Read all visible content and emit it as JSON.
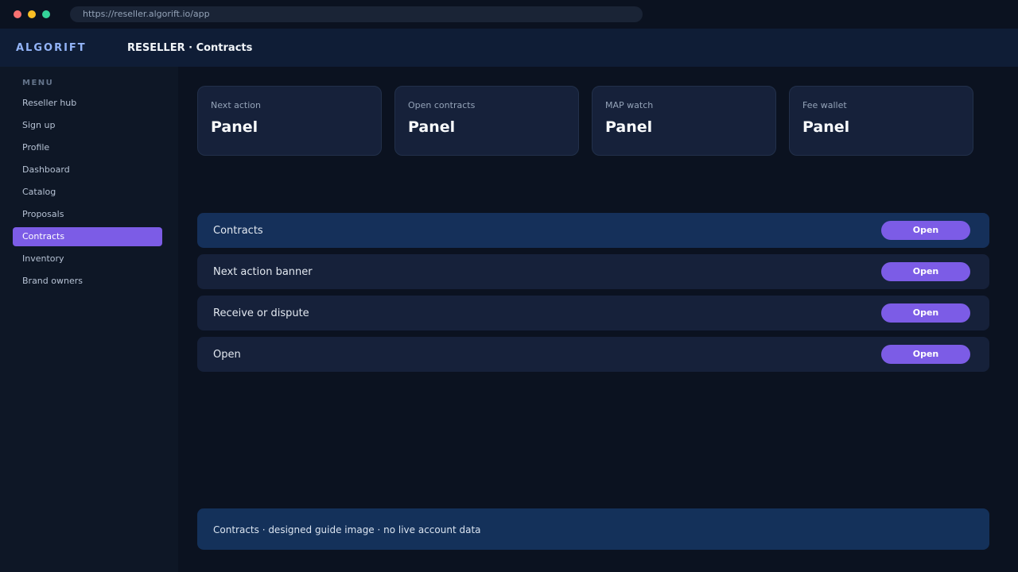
{
  "browser": {
    "url": "https://reseller.algorift.io/app"
  },
  "topnav": {
    "brand": "ALGORIFT",
    "title": "RESELLER · Contracts"
  },
  "sidebar": {
    "heading": "MENU",
    "items": [
      {
        "label": "Reseller hub"
      },
      {
        "label": "Sign up"
      },
      {
        "label": "Profile"
      },
      {
        "label": "Dashboard"
      },
      {
        "label": "Catalog"
      },
      {
        "label": "Proposals"
      },
      {
        "label": "Contracts",
        "active": true
      },
      {
        "label": "Inventory"
      },
      {
        "label": "Brand owners"
      }
    ]
  },
  "cards": [
    {
      "label": "Next action",
      "value": "Panel"
    },
    {
      "label": "Open contracts",
      "value": "Panel"
    },
    {
      "label": "MAP watch",
      "value": "Panel"
    },
    {
      "label": "Fee wallet",
      "value": "Panel"
    }
  ],
  "rows": [
    {
      "label": "Contracts",
      "button": "Open",
      "active": true
    },
    {
      "label": "Next action banner",
      "button": "Open"
    },
    {
      "label": "Receive or dispute",
      "button": "Open"
    },
    {
      "label": "Open",
      "button": "Open"
    }
  ],
  "footer": {
    "note": "Contracts · designed guide image · no live account data"
  },
  "colors": {
    "accent": "#7c5ce6",
    "background": "#0b1220",
    "panel": "#16213a",
    "highlight": "#15305a"
  }
}
